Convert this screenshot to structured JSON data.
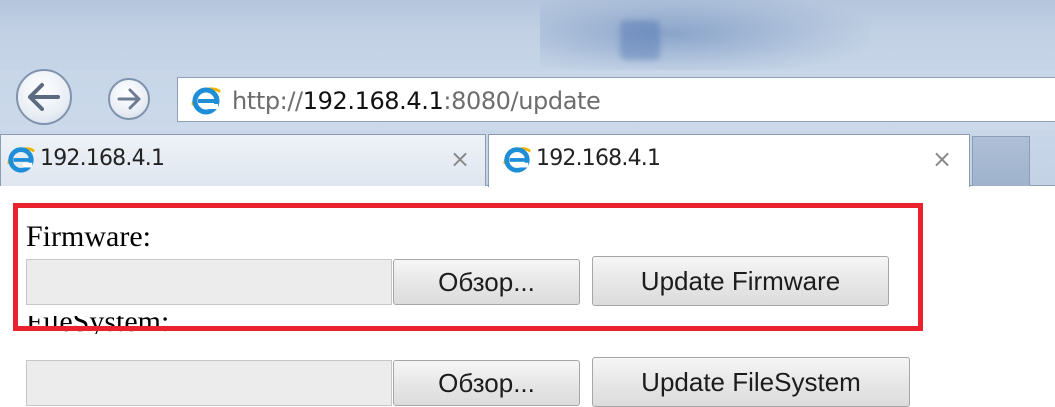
{
  "browser": {
    "address": {
      "scheme": "http://",
      "host": "192.168.4.1",
      "rest": ":8080/update"
    },
    "tabs": [
      {
        "title": "192.168.4.1",
        "close": "×",
        "active": false
      },
      {
        "title": "192.168.4.1",
        "close": "×",
        "active": true
      }
    ]
  },
  "page": {
    "firmware": {
      "label": "Firmware:",
      "browse_label": "Обзор...",
      "submit_label": "Update Firmware"
    },
    "filesystem": {
      "label": "FileSystem:",
      "browse_label": "Обзор...",
      "submit_label": "Update FileSystem"
    }
  },
  "annotation": {
    "highlight_color": "#e8232e"
  },
  "icons": {
    "back": "back-arrow-icon",
    "forward": "forward-arrow-icon",
    "site": "internet-explorer-icon",
    "close": "close-icon"
  }
}
